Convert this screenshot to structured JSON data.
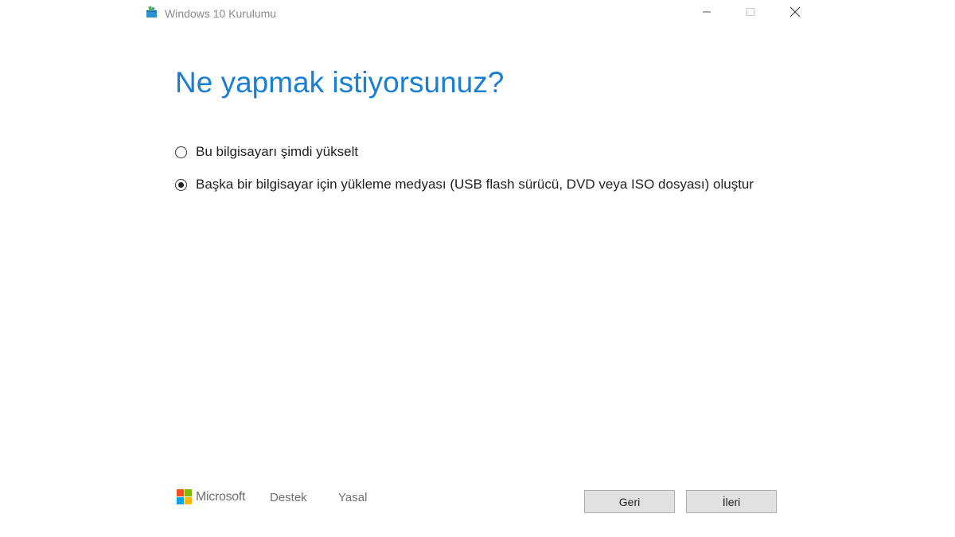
{
  "window": {
    "title": "Windows 10 Kurulumu",
    "app_icon": "setup-icon",
    "controls": {
      "minimize_icon": "minimize-icon",
      "maximize_icon": "maximize-icon",
      "close_icon": "close-icon"
    }
  },
  "main": {
    "heading": "Ne yapmak istiyorsunuz?",
    "options": [
      {
        "label": "Bu bilgisayarı şimdi yükselt",
        "selected": false
      },
      {
        "label": "Başka bir bilgisayar için yükleme medyası (USB flash sürücü, DVD veya ISO dosyası) oluştur",
        "selected": true
      }
    ]
  },
  "footer": {
    "brand": "Microsoft",
    "brand_colors": [
      "#f25022",
      "#7fba00",
      "#00a4ef",
      "#ffb900"
    ],
    "links": {
      "support": "Destek",
      "legal": "Yasal"
    },
    "buttons": {
      "back": "Geri",
      "next": "İleri"
    }
  },
  "colors": {
    "heading": "#1a7fd4",
    "button_bg": "#e1e1e1",
    "button_border": "#adadad"
  }
}
